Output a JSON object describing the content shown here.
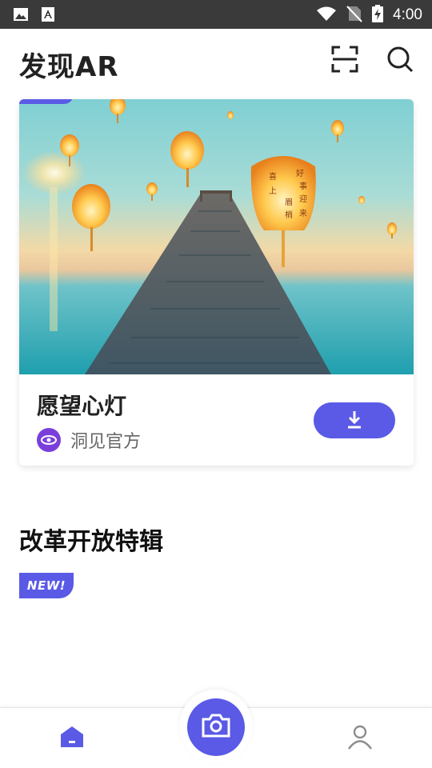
{
  "status_bar": {
    "time": "4:00",
    "icons": [
      "image-icon",
      "text-notification-icon",
      "wifi-icon",
      "no-sim-icon",
      "battery-charging-icon"
    ]
  },
  "header": {
    "title": "发现AR",
    "icons": [
      "scan-icon",
      "search-icon"
    ]
  },
  "featured_card": {
    "title": "愿望心灯",
    "author": "洞见官方",
    "image": "sky-lanterns-over-pier-photo",
    "lantern_text": [
      "喜",
      "上",
      "眉",
      "梢",
      "好",
      "事",
      "迎",
      "来"
    ],
    "download_icon": "download-icon"
  },
  "section": {
    "title": "改革开放特辑",
    "badge": "NEW!"
  },
  "bottom_nav": {
    "items": [
      "home-icon",
      "camera-icon",
      "profile-icon"
    ]
  },
  "colors": {
    "accent": "#5a5ae6",
    "status_bar": "#3a3a3a",
    "avatar": "#7a3fdb"
  }
}
